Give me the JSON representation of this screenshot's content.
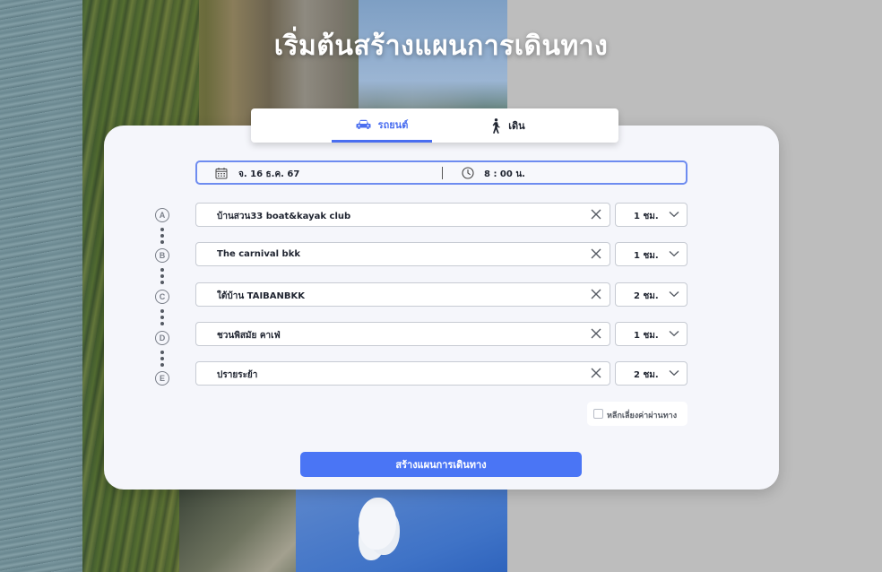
{
  "page": {
    "headline": "เริ่มต้นสร้างแผนการเดินทาง"
  },
  "mode_tabs": [
    {
      "label": "รถยนต์",
      "icon": "car-icon",
      "active": true
    },
    {
      "label": "เดิน",
      "icon": "walking-person-icon",
      "active": false
    }
  ],
  "datetime": {
    "date": "จ. 16 ธ.ค. 67",
    "time": "8 : 00 น.",
    "date_icon": "calendar-icon",
    "time_icon": "clock-icon"
  },
  "stops": [
    {
      "marker": "A",
      "place": "บ้านสวน33 boat&kayak club",
      "duration": "1 ชม."
    },
    {
      "marker": "B",
      "place": "The carnival bkk",
      "duration": "1 ชม."
    },
    {
      "marker": "C",
      "place": "ใต้บ้าน TAIBANBKK",
      "duration": "2 ชม."
    },
    {
      "marker": "D",
      "place": "ชวนพิสมัย คาเฟ่",
      "duration": "1 ชม."
    },
    {
      "marker": "E",
      "place": "ปรายระย้า",
      "duration": "2 ชม."
    }
  ],
  "options": {
    "avoid_tolls_label": "หลีกเลี่ยงค่าผ่านทาง",
    "avoid_tolls_checked": false
  },
  "actions": {
    "submit_label": "สร้างแผนการเดินทาง"
  },
  "colors": {
    "accent": "#4a75f5",
    "card_bg": "#f5f6fb",
    "page_bg": "#bdbdbd"
  }
}
